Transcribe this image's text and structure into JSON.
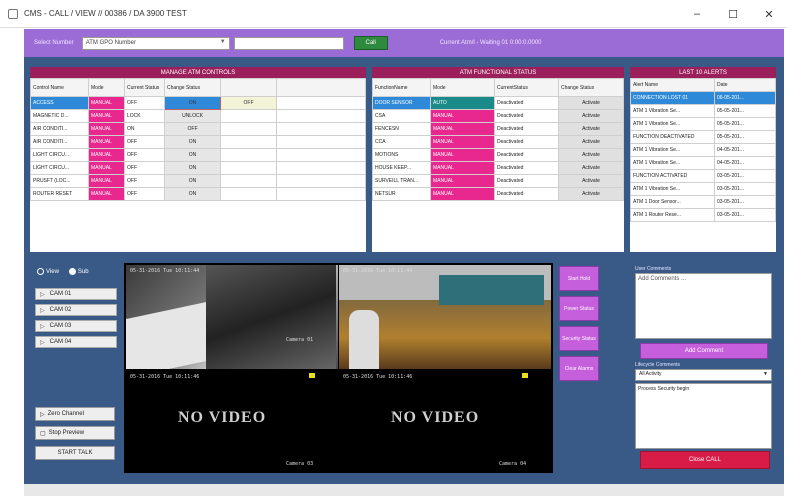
{
  "window": {
    "title": "CMS - CALL / VIEW // 00386 / DA 3900 TEST"
  },
  "topbar": {
    "label": "Select Number",
    "select_value": "ATM GPO Number",
    "go_label": "Call",
    "status": "Current Atm/l - Waiting 01 0:00:0.0000"
  },
  "manage": {
    "title": "MANAGE ATM CONTROLS",
    "headers": [
      "Control Name",
      "Mode",
      "Current Status",
      "Change Status"
    ],
    "rows": [
      {
        "name": "ACCESS",
        "mode": "MANUAL",
        "status": "OFF",
        "action": "ON",
        "extra": "OFF"
      },
      {
        "name": "MAGNETIC D...",
        "mode": "MANUAL",
        "status": "LOCK",
        "action": "UNLOCK",
        "extra": ""
      },
      {
        "name": "AIR CONDITI...",
        "mode": "MANUAL",
        "status": "ON",
        "action": "OFF",
        "extra": ""
      },
      {
        "name": "AIR CONDITI...",
        "mode": "MANUAL",
        "status": "OFF",
        "action": "ON",
        "extra": ""
      },
      {
        "name": "LIGHT CIRCU...",
        "mode": "MANUAL",
        "status": "OFF",
        "action": "ON",
        "extra": ""
      },
      {
        "name": "LIGHT CIRCU...",
        "mode": "MANUAL",
        "status": "OFF",
        "action": "ON",
        "extra": ""
      },
      {
        "name": "PRUSFT (LOC...",
        "mode": "MANUAL",
        "status": "OFF",
        "action": "ON",
        "extra": ""
      },
      {
        "name": "ROUTER RESET",
        "mode": "MANUAL",
        "status": "OFF",
        "action": "ON",
        "extra": ""
      }
    ]
  },
  "functional": {
    "title": "ATM FUNCTIONAL STATUS",
    "headers": [
      "FunctionName",
      "Mode",
      "CurrentStatus",
      "Change Status"
    ],
    "rows": [
      {
        "name": "DOOR SENSOR",
        "mode": "AUTO",
        "status": "Deactivated",
        "action": "Activate"
      },
      {
        "name": "CSA",
        "mode": "MANUAL",
        "status": "Deactivated",
        "action": "Activate"
      },
      {
        "name": "FENCESN",
        "mode": "MANUAL",
        "status": "Deactivated",
        "action": "Activate"
      },
      {
        "name": "CCA",
        "mode": "MANUAL",
        "status": "Deactivated",
        "action": "Activate"
      },
      {
        "name": "MOTIONS",
        "mode": "MANUAL",
        "status": "Deactivated",
        "action": "Activate"
      },
      {
        "name": "HOUSE KEEP...",
        "mode": "MANUAL",
        "status": "Deactivated",
        "action": "Activate"
      },
      {
        "name": "SURVEILL TRAN...",
        "mode": "MANUAL",
        "status": "Deactivated",
        "action": "Activate"
      },
      {
        "name": "NETSUR",
        "mode": "MANUAL",
        "status": "Deactivated",
        "action": "Activate"
      }
    ]
  },
  "alerts": {
    "title": "LAST 10 ALERTS",
    "headers": [
      "Alert Name",
      "Date"
    ],
    "rows": [
      {
        "name": "CONNECTION LOST 01",
        "date": "06-05-201..."
      },
      {
        "name": "ATM 1 Vibration Se...",
        "date": "05-05-201..."
      },
      {
        "name": "ATM 1 Vibration Se...",
        "date": "05-05-201..."
      },
      {
        "name": "FUNCTION DEACTIVATED",
        "date": "05-05-201..."
      },
      {
        "name": "ATM 1 Vibration Se...",
        "date": "04-05-201..."
      },
      {
        "name": "ATM 1 Vibration Se...",
        "date": "04-05-201..."
      },
      {
        "name": "FUNCTION ACTIVATED",
        "date": "03-05-201..."
      },
      {
        "name": "ATM 1 Vibration Se...",
        "date": "03-05-201..."
      },
      {
        "name": "ATM 1 Door Sensor...",
        "date": "03-05-201..."
      },
      {
        "name": "ATM 1 Router Rese...",
        "date": "03-05-201..."
      }
    ]
  },
  "view_mode": {
    "option1": "View",
    "option2": "Sub"
  },
  "cameras": [
    "CAM 01",
    "CAM 02",
    "CAM 03",
    "CAM 04"
  ],
  "left_buttons": {
    "zero_channel": "Zero Channel",
    "stop_preview": "Stop Preview",
    "start_talk": "START TALK"
  },
  "video": {
    "cam1_time": "05-31-2016 Tue 10:11:44",
    "cam1_label": "Camera 01",
    "cam2_time": "05-31-2016 Tue 10:11:44",
    "cam3_time": "05-31-2016 Tue 10:11:46",
    "cam3_label": "Camera 03",
    "cam4_time": "05-31-2016 Tue 10:11:46",
    "cam4_label": "Camera 04",
    "no_video": "NO VIDEO"
  },
  "video_buttons": [
    "Start Hold",
    "Power Status",
    "Security Status",
    "Clear Alarms"
  ],
  "comments": {
    "user_label": "User Comments",
    "user_placeholder": "Add Comments ...",
    "add_button": "Add Comment",
    "system_label": "Lifecycle Comments",
    "system_select": "All Activity",
    "system_text": "Process Security begin",
    "close_button": "Close CALL"
  }
}
